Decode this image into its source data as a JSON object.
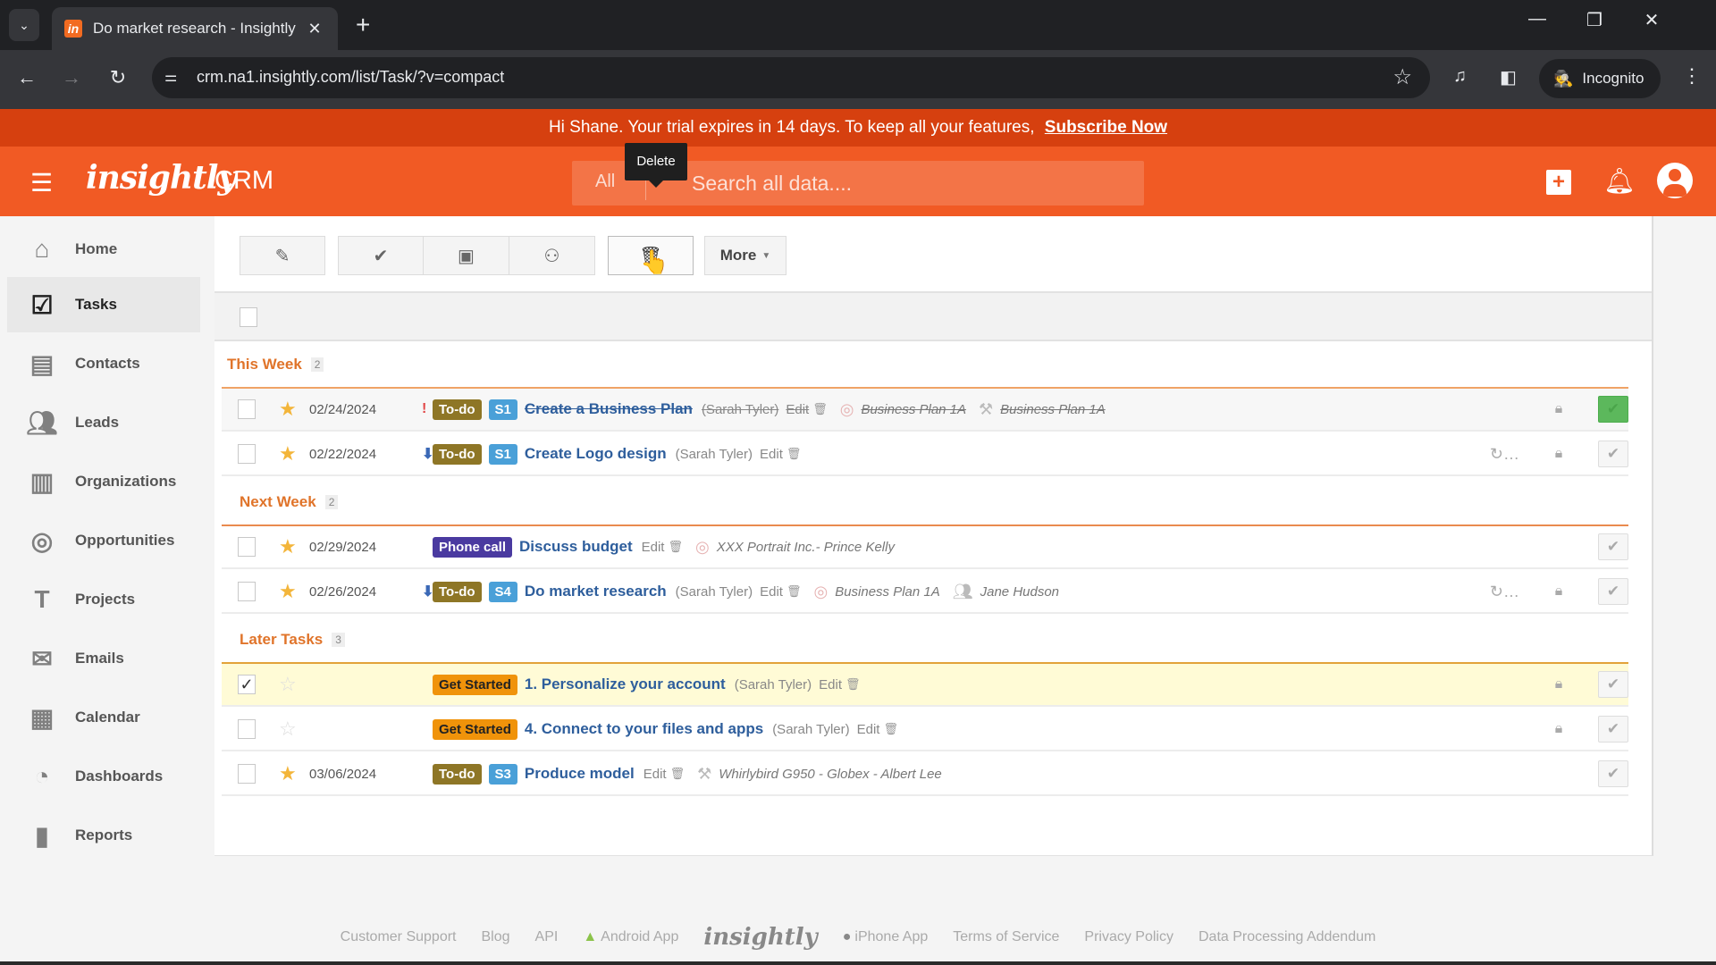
{
  "browser": {
    "tab_title": "Do market research - Insightly",
    "favicon_text": "in",
    "url": "crm.na1.insightly.com/list/Task/?v=compact",
    "incognito_label": "Incognito"
  },
  "banner": {
    "message": "Hi Shane. Your trial expires in 14 days. To keep all your features,",
    "link": "Subscribe Now"
  },
  "header": {
    "logo": "insightly",
    "product": "CRM",
    "search_scope": "All",
    "search_placeholder": "Search all data....",
    "tooltip": "Delete"
  },
  "sidebar": {
    "items": [
      {
        "label": "Home",
        "icon": "home-icon"
      },
      {
        "label": "Tasks",
        "icon": "tasks-icon",
        "active": true
      },
      {
        "label": "Contacts",
        "icon": "contacts-icon"
      },
      {
        "label": "Leads",
        "icon": "leads-icon"
      },
      {
        "label": "Organizations",
        "icon": "organizations-icon"
      },
      {
        "label": "Opportunities",
        "icon": "opportunities-icon"
      },
      {
        "label": "Projects",
        "icon": "projects-icon"
      },
      {
        "label": "Emails",
        "icon": "emails-icon"
      },
      {
        "label": "Calendar",
        "icon": "calendar-icon"
      },
      {
        "label": "Dashboards",
        "icon": "dashboards-icon"
      },
      {
        "label": "Reports",
        "icon": "reports-icon"
      }
    ]
  },
  "toolbar": {
    "more_label": "More"
  },
  "groups": [
    {
      "title": "This Week",
      "count": "2",
      "rows": [
        {
          "date": "02/24/2024",
          "priority": "high",
          "type": "To-do",
          "stage": "S1",
          "title": "Create a Business Plan",
          "owner": "(Sarah Tyler)",
          "edit": "Edit",
          "related1": "Business Plan 1A",
          "related2": "Business Plan 1A",
          "completed": true,
          "starred": true,
          "locked": true
        },
        {
          "date": "02/22/2024",
          "priority": "low",
          "type": "To-do",
          "stage": "S1",
          "title": "Create Logo design",
          "owner": "(Sarah Tyler)",
          "edit": "Edit",
          "recurring": "…",
          "starred": true,
          "locked": true
        }
      ]
    },
    {
      "title": "Next Week",
      "count": "2",
      "rows": [
        {
          "date": "02/29/2024",
          "type": "Phone call",
          "title": "Discuss budget",
          "edit": "Edit",
          "related1": "XXX Portrait Inc.- Prince Kelly",
          "starred": true
        },
        {
          "date": "02/26/2024",
          "priority": "low",
          "type": "To-do",
          "stage": "S4",
          "title": "Do market research",
          "owner": "(Sarah Tyler)",
          "edit": "Edit",
          "related1": "Business Plan 1A",
          "related2": "Jane Hudson",
          "recurring": "…",
          "starred": true,
          "locked": true
        }
      ]
    },
    {
      "title": "Later Tasks",
      "count": "3",
      "rows": [
        {
          "date": "",
          "type": "Get Started",
          "title": "1. Personalize your account",
          "owner": "(Sarah Tyler)",
          "edit": "Edit",
          "selected": true,
          "starred": false,
          "locked": true
        },
        {
          "date": "",
          "type": "Get Started",
          "title": "4. Connect to your files and apps",
          "owner": "(Sarah Tyler)",
          "edit": "Edit",
          "starred": false,
          "locked": true
        },
        {
          "date": "03/06/2024",
          "type": "To-do",
          "stage": "S3",
          "title": "Produce model",
          "edit": "Edit",
          "related1": "Whirlybird G950 - Globex - Albert Lee",
          "starred": true
        }
      ]
    }
  ],
  "footer": {
    "links": [
      "Customer Support",
      "Blog",
      "API",
      "Android App",
      "iPhone App",
      "Terms of Service",
      "Privacy Policy",
      "Data Processing Addendum"
    ],
    "logo": "insightly"
  },
  "colors": {
    "brand": "#f15a24",
    "banner": "#d6400f",
    "group_header": "#e0742a",
    "todo_badge": "#8e7626",
    "phone_badge": "#4a3aa0",
    "get_started_badge": "#f0930a",
    "stage_badge": "#4aa0d8",
    "complete_green": "#5cb85c"
  }
}
